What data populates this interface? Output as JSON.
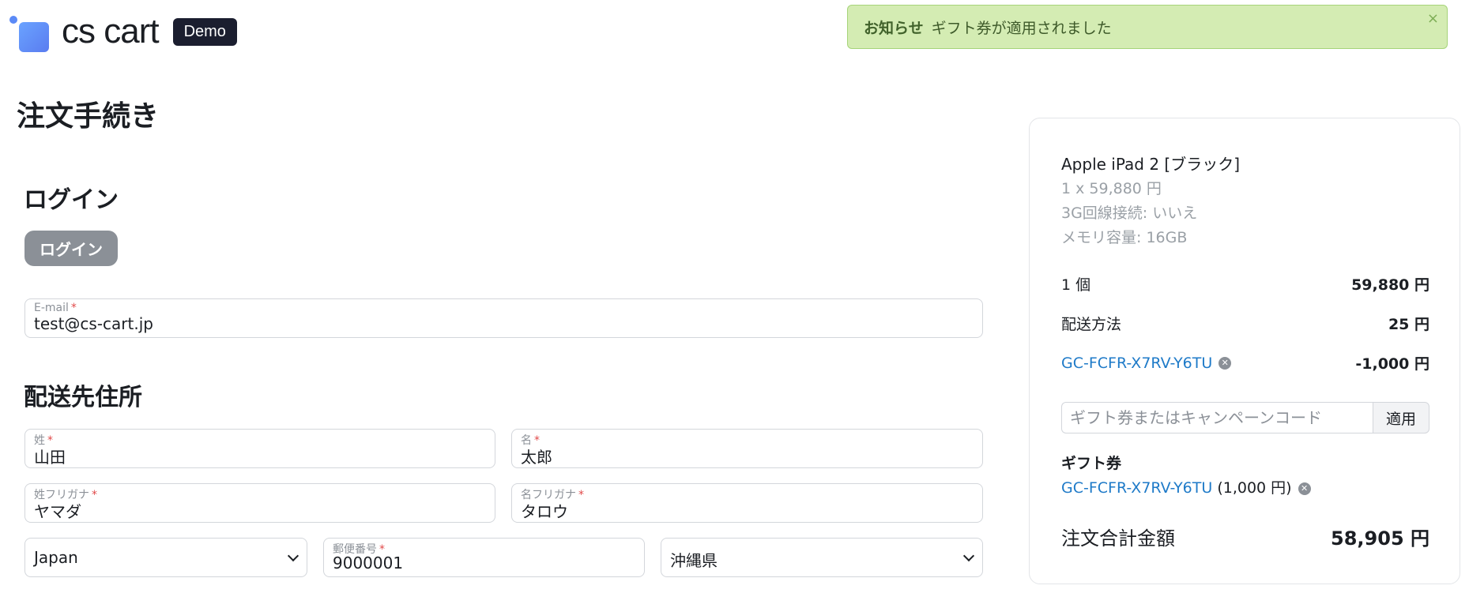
{
  "brand": {
    "name": "cs cart",
    "badge": "Demo"
  },
  "notice": {
    "title": "お知らせ",
    "message": "ギフト券が適用されました",
    "close": "×"
  },
  "page_title": "注文手続き",
  "login_section": {
    "title": "ログイン",
    "button": "ログイン",
    "email_label": "E-mail",
    "email_value": "test@cs-cart.jp"
  },
  "shipping_section": {
    "title": "配送先住所",
    "last_name_label": "姓",
    "last_name_value": "山田",
    "first_name_label": "名",
    "first_name_value": "太郎",
    "last_kana_label": "姓フリガナ",
    "last_kana_value": "ヤマダ",
    "first_kana_label": "名フリガナ",
    "first_kana_value": "タロウ",
    "country_value": "Japan",
    "zip_label": "郵便番号",
    "zip_value": "9000001",
    "prefecture_value": "沖縄県",
    "required_mark": "*"
  },
  "summary": {
    "product_name": "Apple iPad 2 [ブラック]",
    "product_qty_price": "1 x 59,880 円",
    "option_3g": "3G回線接続: いいえ",
    "option_memory": "メモリ容量: 16GB",
    "items_label": "1 個",
    "items_value": "59,880 円",
    "shipping_label": "配送方法",
    "shipping_value": "25 円",
    "discount_code": "GC-FCFR-X7RV-Y6TU",
    "discount_value": "-1,000 円",
    "gift_input_placeholder": "ギフト券またはキャンペーンコード",
    "apply_button": "適用",
    "gift_title": "ギフト券",
    "gift_code": "GC-FCFR-X7RV-Y6TU",
    "gift_amount": "(1,000 円)",
    "total_label": "注文合計金額",
    "total_value": "58,905 円"
  }
}
